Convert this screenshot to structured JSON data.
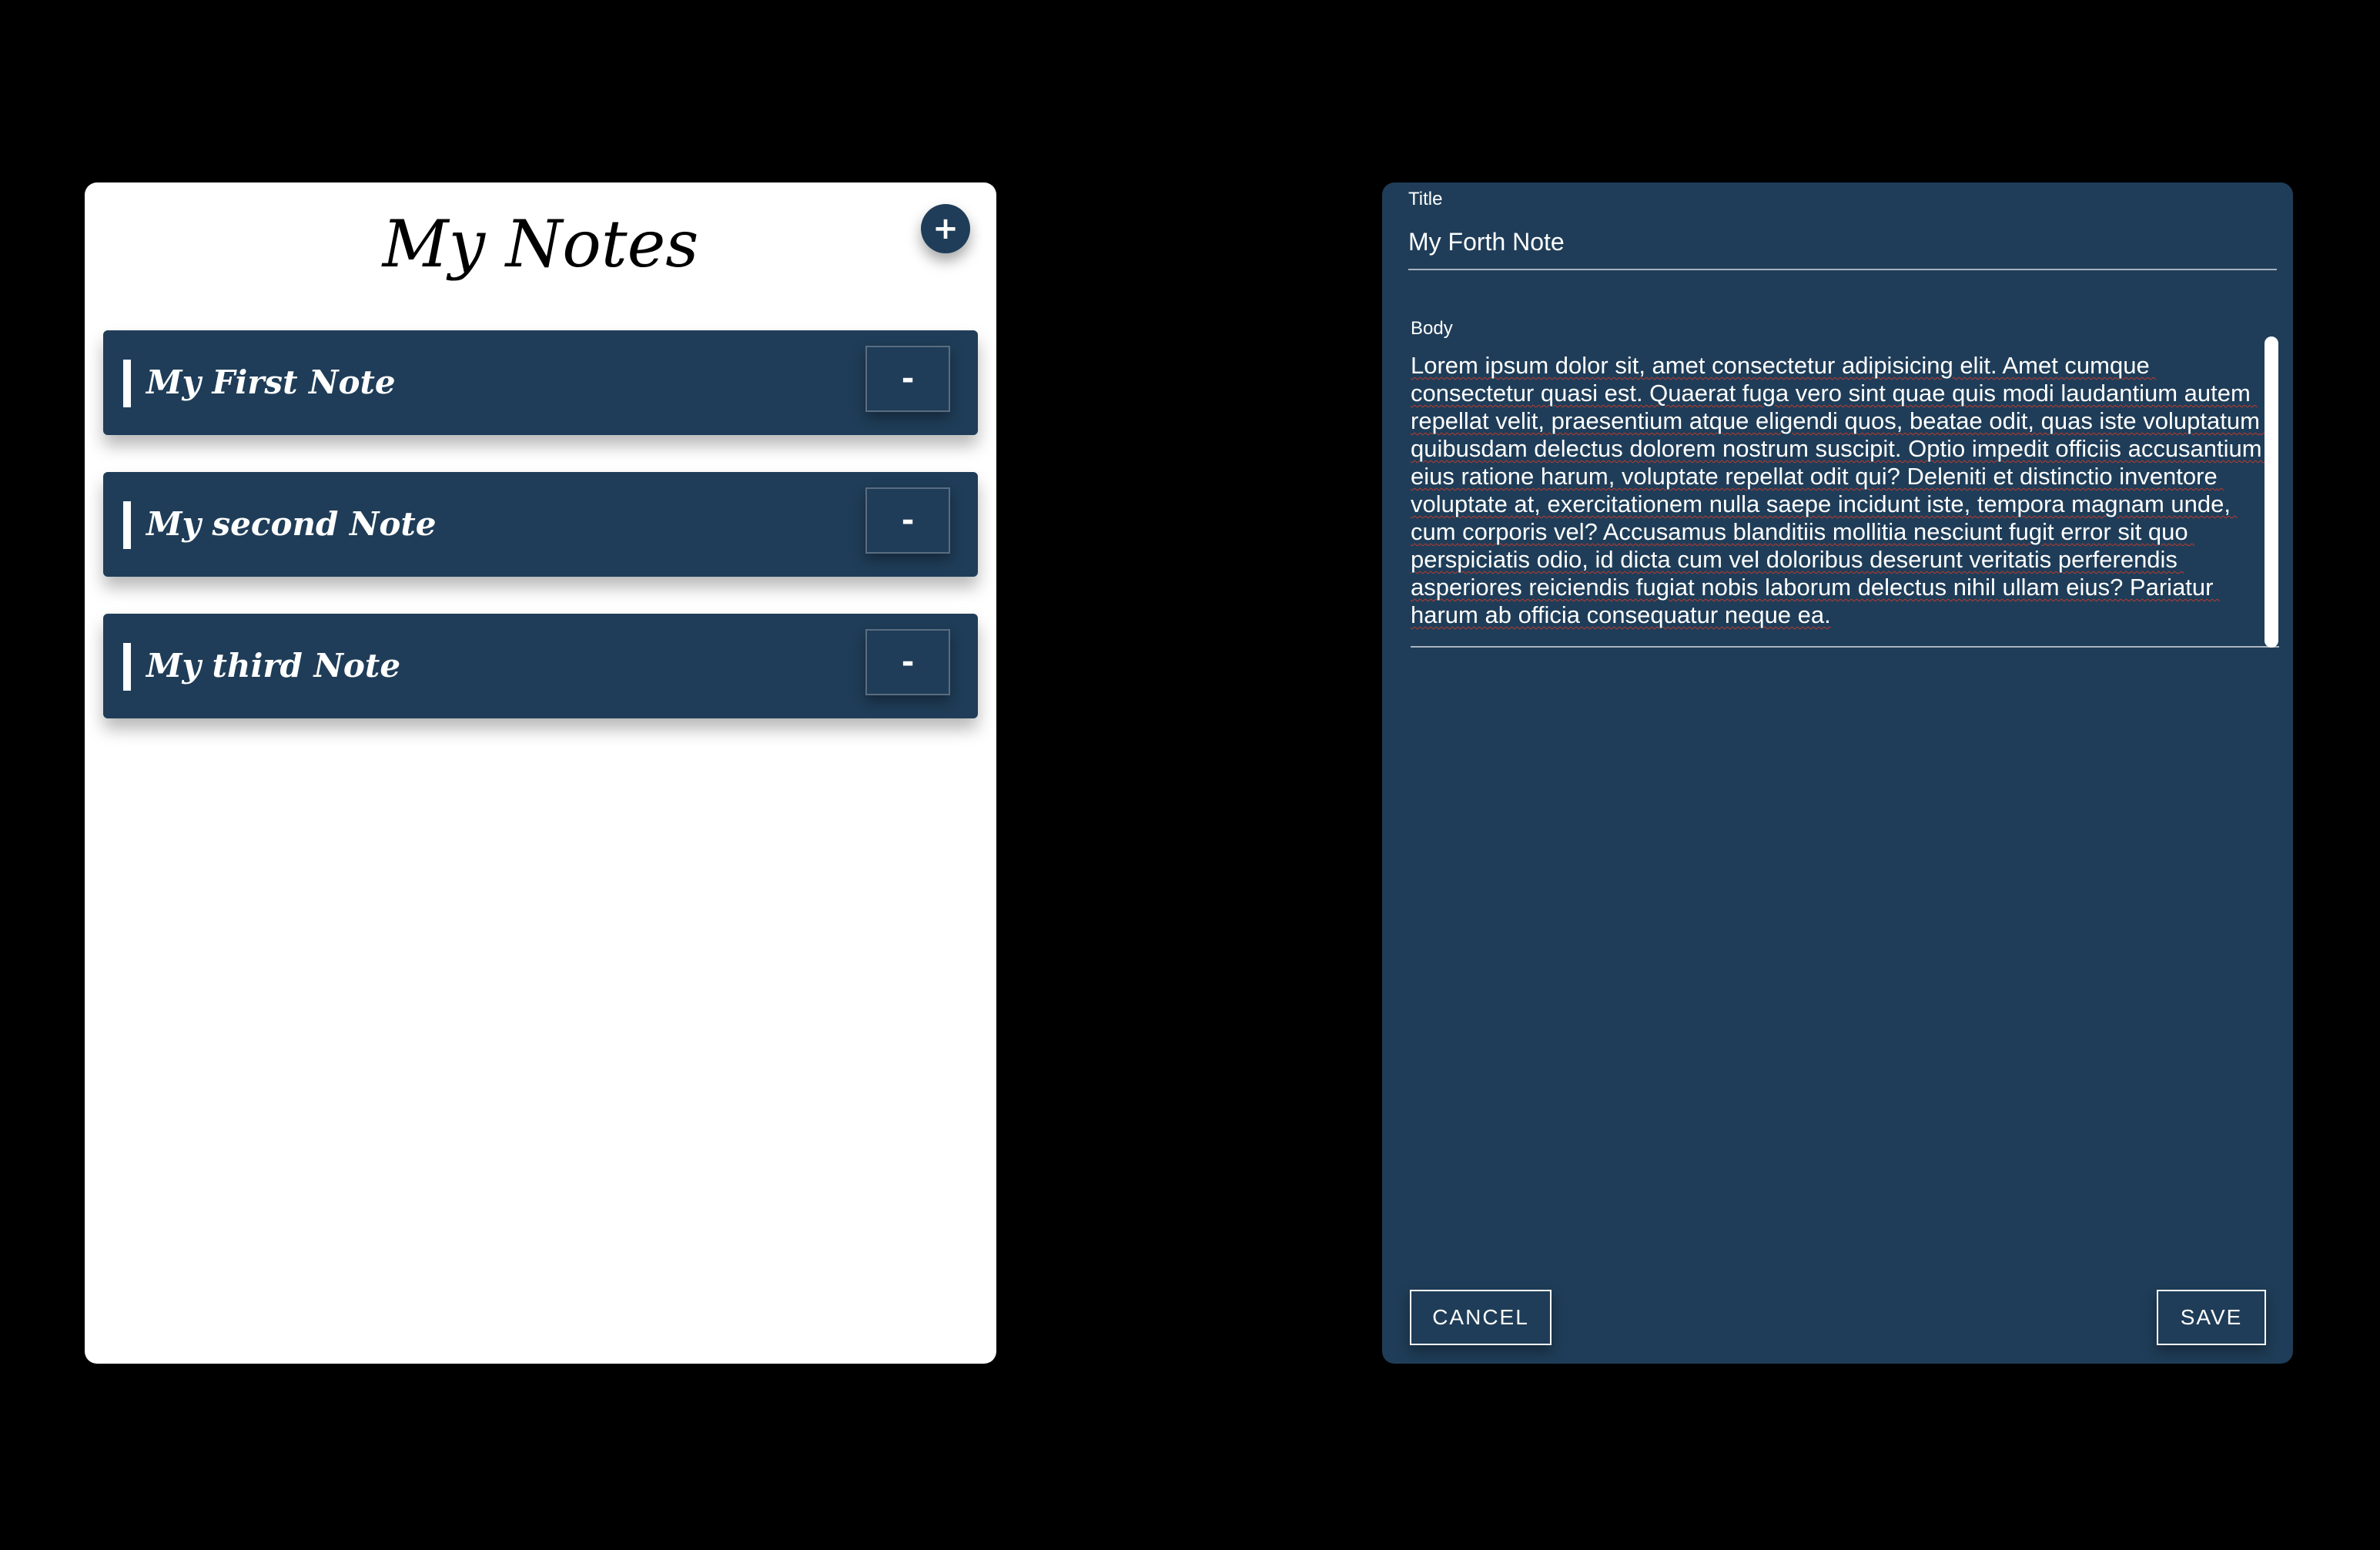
{
  "notes_panel": {
    "title": "My Notes",
    "add_label": "+",
    "remove_label": "-",
    "notes": [
      {
        "label": "My First Note"
      },
      {
        "label": "My second Note"
      },
      {
        "label": "My third Note"
      }
    ]
  },
  "editor": {
    "title_label": "Title",
    "title_value": "My Forth Note",
    "body_label": "Body",
    "body_value": "Lorem ipsum dolor sit, amet consectetur adipisicing elit. Amet cumque consectetur quasi est. Quaerat fuga vero sint quae quis modi laudantium autem repellat velit, praesentium atque eligendi quos, beatae odit, quas iste voluptatum quibusdam delectus dolorem nostrum suscipit. Optio impedit officiis accusantium eius ratione harum, voluptate repellat odit qui? Deleniti et distinctio inventore voluptate at, exercitationem nulla saepe incidunt iste, tempora magnam unde, cum corporis vel? Accusamus blanditiis mollitia nesciunt fugit error sit quo perspiciatis odio, id dicta cum vel doloribus deserunt veritatis perferendis asperiores reiciendis fugiat nobis laborum delectus nihil ullam eius? Pariatur harum ab officia consequatur neque ea.",
    "cancel_label": "CANCEL",
    "save_label": "SAVE"
  },
  "colors": {
    "primary": "#1f3d58",
    "background": "#000000",
    "panel": "#ffffff"
  },
  "icons": {
    "add": "plus-icon",
    "remove": "minus-icon"
  }
}
